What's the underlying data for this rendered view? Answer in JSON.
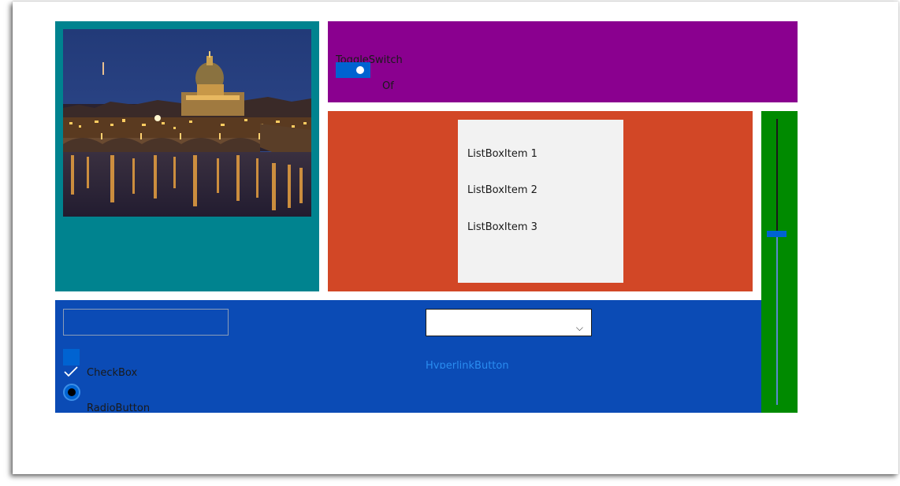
{
  "image_panel": {
    "alt": "Night view of Rome with St. Peter's Basilica and bridge over the Tiber"
  },
  "toggle": {
    "header": "ToggleSwitch",
    "state_label": "Of"
  },
  "listbox": {
    "items": [
      "ListBoxItem 1",
      "ListBoxItem 2",
      "ListBoxItem 3"
    ]
  },
  "slider": {
    "value_fraction": 0.4
  },
  "textbox": {
    "value": ""
  },
  "combobox": {
    "selected": "",
    "chevron": "⌵"
  },
  "checkbox": {
    "label": "CheckBox",
    "checked": true
  },
  "radio": {
    "label": "RadioButton",
    "selected": true
  },
  "hyperlink": {
    "label": "HyperlinkButton"
  },
  "colors": {
    "teal": "#00838f",
    "purple": "#8a008f",
    "orange": "#d24726",
    "green": "#008a00",
    "blue": "#0b4bb5",
    "accent": "#0063d1"
  }
}
